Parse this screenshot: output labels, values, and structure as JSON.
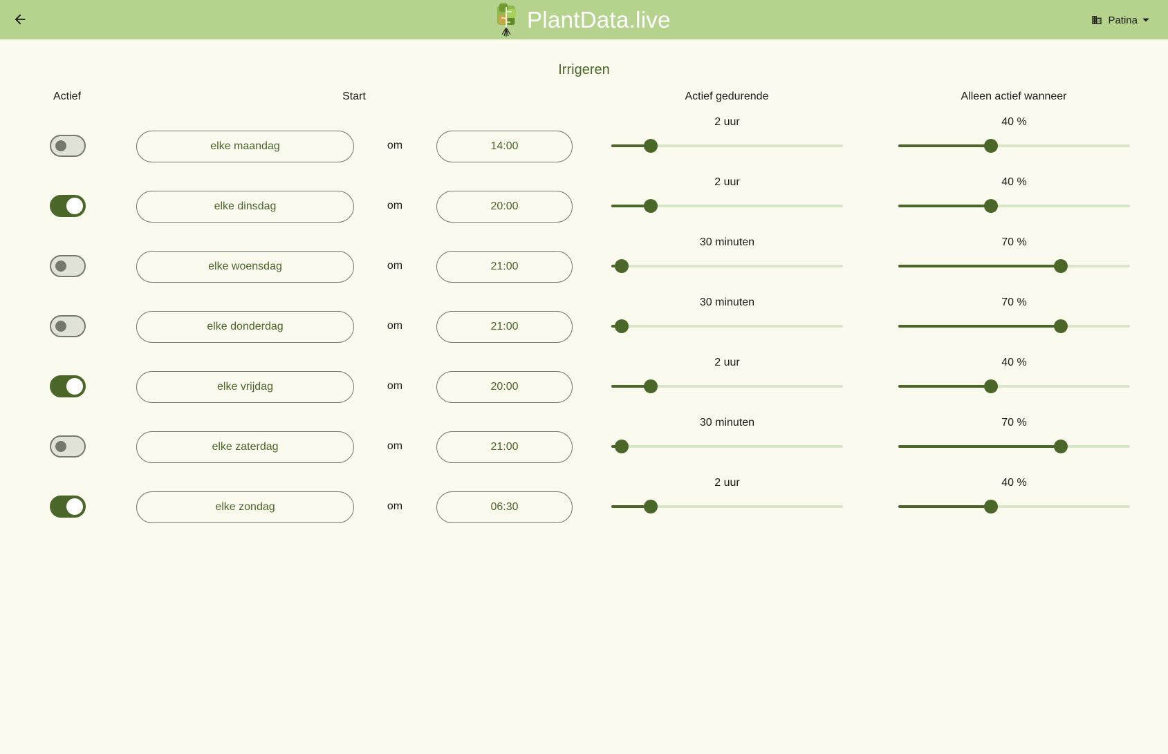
{
  "app": {
    "title": "PlantData.live",
    "location": "Patina",
    "back_icon": "arrow-back-icon",
    "location_icon": "building-icon",
    "dropdown_icon": "caret-down-icon",
    "colors": {
      "appbar": "#b6d38e",
      "background": "#fafaef",
      "primary": "#4a6628",
      "track_inactive": "#d9e7c8",
      "outline": "#75796c"
    }
  },
  "page": {
    "title": "Irrigeren",
    "headers": {
      "active": "Actief",
      "start": "Start",
      "duration": "Actief gedurende",
      "condition": "Alleen actief wanneer"
    }
  },
  "schedule": [
    {
      "active": false,
      "day": "elke maandag",
      "at": "om",
      "time": "14:00",
      "duration_label": "2 uur",
      "duration_fraction": 0.17,
      "condition_label": "40 %",
      "condition_fraction": 0.4
    },
    {
      "active": true,
      "day": "elke dinsdag",
      "at": "om",
      "time": "20:00",
      "duration_label": "2 uur",
      "duration_fraction": 0.17,
      "condition_label": "40 %",
      "condition_fraction": 0.4
    },
    {
      "active": false,
      "day": "elke woensdag",
      "at": "om",
      "time": "21:00",
      "duration_label": "30 minuten",
      "duration_fraction": 0.045,
      "condition_label": "70 %",
      "condition_fraction": 0.7
    },
    {
      "active": false,
      "day": "elke donderdag",
      "at": "om",
      "time": "21:00",
      "duration_label": "30 minuten",
      "duration_fraction": 0.045,
      "condition_label": "70 %",
      "condition_fraction": 0.7
    },
    {
      "active": true,
      "day": "elke vrijdag",
      "at": "om",
      "time": "20:00",
      "duration_label": "2 uur",
      "duration_fraction": 0.17,
      "condition_label": "40 %",
      "condition_fraction": 0.4
    },
    {
      "active": false,
      "day": "elke zaterdag",
      "at": "om",
      "time": "21:00",
      "duration_label": "30 minuten",
      "duration_fraction": 0.045,
      "condition_label": "70 %",
      "condition_fraction": 0.7
    },
    {
      "active": true,
      "day": "elke zondag",
      "at": "om",
      "time": "06:30",
      "duration_label": "2 uur",
      "duration_fraction": 0.17,
      "condition_label": "40 %",
      "condition_fraction": 0.4
    }
  ]
}
